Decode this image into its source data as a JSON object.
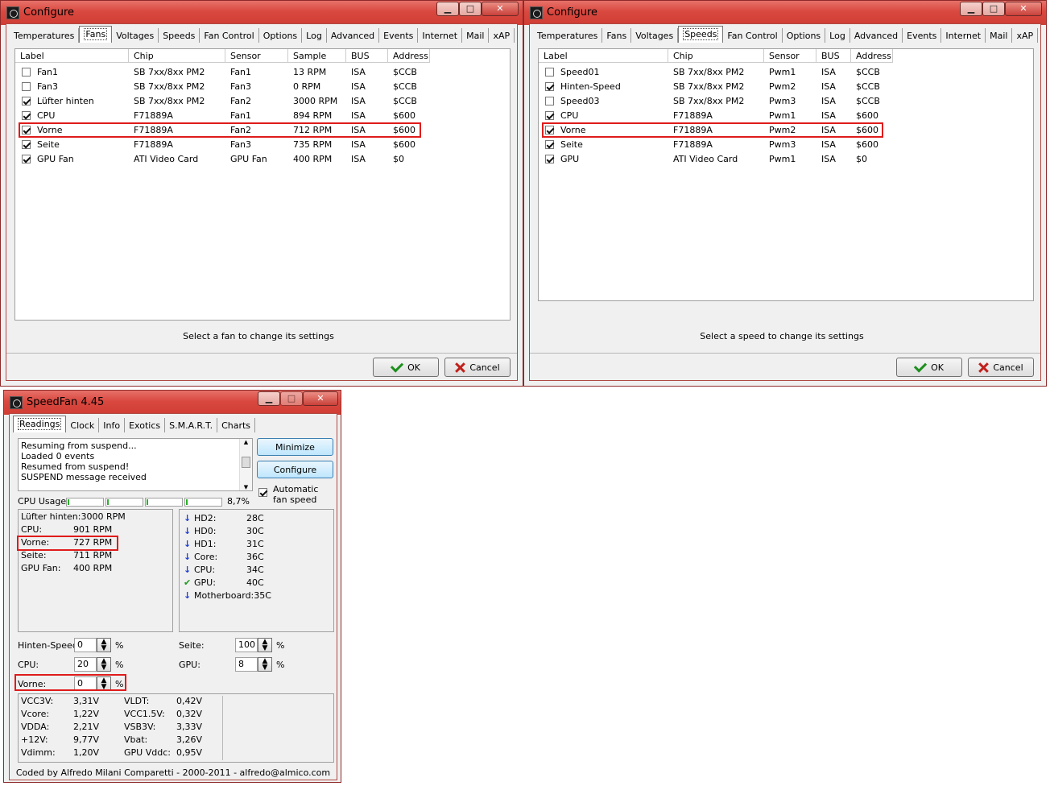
{
  "window1": {
    "title": "Configure",
    "tabs": [
      "Temperatures",
      "Fans",
      "Voltages",
      "Speeds",
      "Fan Control",
      "Options",
      "Log",
      "Advanced",
      "Events",
      "Internet",
      "Mail",
      "xAP"
    ],
    "selected_tab": "Fans",
    "columns": [
      "Label",
      "Chip",
      "Sensor",
      "Sample",
      "BUS",
      "Address"
    ],
    "rows": [
      {
        "checked": false,
        "label": "Fan1",
        "chip": "SB 7xx/8xx PM2",
        "sensor": "Fan1",
        "sample": "13 RPM",
        "bus": "ISA",
        "address": "$CCB"
      },
      {
        "checked": false,
        "label": "Fan3",
        "chip": "SB 7xx/8xx PM2",
        "sensor": "Fan3",
        "sample": "0 RPM",
        "bus": "ISA",
        "address": "$CCB"
      },
      {
        "checked": true,
        "label": "Lüfter hinten",
        "chip": "SB 7xx/8xx PM2",
        "sensor": "Fan2",
        "sample": "3000 RPM",
        "bus": "ISA",
        "address": "$CCB"
      },
      {
        "checked": true,
        "label": "CPU",
        "chip": "F71889A",
        "sensor": "Fan1",
        "sample": "894 RPM",
        "bus": "ISA",
        "address": "$600"
      },
      {
        "checked": true,
        "label": "Vorne",
        "chip": "F71889A",
        "sensor": "Fan2",
        "sample": "712 RPM",
        "bus": "ISA",
        "address": "$600"
      },
      {
        "checked": true,
        "label": "Seite",
        "chip": "F71889A",
        "sensor": "Fan3",
        "sample": "735 RPM",
        "bus": "ISA",
        "address": "$600"
      },
      {
        "checked": true,
        "label": "GPU Fan",
        "chip": "ATI Video Card",
        "sensor": "GPU Fan",
        "sample": "400 RPM",
        "bus": "ISA",
        "address": "$0"
      }
    ],
    "hint": "Select a fan to change its settings",
    "ok_label": "OK",
    "cancel_label": "Cancel"
  },
  "window2": {
    "title": "Configure",
    "tabs": [
      "Temperatures",
      "Fans",
      "Voltages",
      "Speeds",
      "Fan Control",
      "Options",
      "Log",
      "Advanced",
      "Events",
      "Internet",
      "Mail",
      "xAP"
    ],
    "selected_tab": "Speeds",
    "columns": [
      "Label",
      "Chip",
      "Sensor",
      "BUS",
      "Address"
    ],
    "rows": [
      {
        "checked": false,
        "label": "Speed01",
        "chip": "SB 7xx/8xx PM2",
        "sensor": "Pwm1",
        "bus": "ISA",
        "address": "$CCB"
      },
      {
        "checked": true,
        "label": "Hinten-Speed",
        "chip": "SB 7xx/8xx PM2",
        "sensor": "Pwm2",
        "bus": "ISA",
        "address": "$CCB"
      },
      {
        "checked": false,
        "label": "Speed03",
        "chip": "SB 7xx/8xx PM2",
        "sensor": "Pwm3",
        "bus": "ISA",
        "address": "$CCB"
      },
      {
        "checked": true,
        "label": "CPU",
        "chip": "F71889A",
        "sensor": "Pwm1",
        "bus": "ISA",
        "address": "$600"
      },
      {
        "checked": true,
        "label": "Vorne",
        "chip": "F71889A",
        "sensor": "Pwm2",
        "bus": "ISA",
        "address": "$600"
      },
      {
        "checked": true,
        "label": "Seite",
        "chip": "F71889A",
        "sensor": "Pwm3",
        "bus": "ISA",
        "address": "$600"
      },
      {
        "checked": true,
        "label": "GPU",
        "chip": "ATI Video Card",
        "sensor": "Pwm1",
        "bus": "ISA",
        "address": "$0"
      }
    ],
    "hint": "Select a speed to change its settings",
    "ok_label": "OK",
    "cancel_label": "Cancel"
  },
  "speedfan": {
    "title": "SpeedFan 4.45",
    "tabs": [
      "Readings",
      "Clock",
      "Info",
      "Exotics",
      "S.M.A.R.T.",
      "Charts"
    ],
    "log": [
      "Resuming from suspend...",
      "Loaded 0 events",
      "Resumed from suspend!",
      "SUSPEND message received"
    ],
    "minimize_label": "Minimize",
    "configure_label": "Configure",
    "auto_fan_label": "Automatic fan speed",
    "auto_fan_checked": true,
    "cpu_usage_label": "CPU Usage",
    "cpu_usage_value": "8,7%",
    "fans": [
      {
        "name": "Lüfter hinten:",
        "value": "3000 RPM"
      },
      {
        "name": "CPU:",
        "value": "901 RPM"
      },
      {
        "name": "Vorne:",
        "value": "727 RPM"
      },
      {
        "name": "Seite:",
        "value": "711 RPM"
      },
      {
        "name": "GPU Fan:",
        "value": "400 RPM"
      }
    ],
    "temps": [
      {
        "name": "HD2:",
        "value": "28C",
        "icon": "arrow-down-icon"
      },
      {
        "name": "HD0:",
        "value": "30C",
        "icon": "arrow-down-icon"
      },
      {
        "name": "HD1:",
        "value": "31C",
        "icon": "arrow-down-icon"
      },
      {
        "name": "Core:",
        "value": "36C",
        "icon": "arrow-down-icon"
      },
      {
        "name": "CPU:",
        "value": "34C",
        "icon": "arrow-down-icon"
      },
      {
        "name": "GPU:",
        "value": "40C",
        "icon": "check-icon"
      },
      {
        "name": "Motherboard:",
        "value": "35C",
        "icon": "arrow-down-icon"
      }
    ],
    "speeds": [
      {
        "name": "Hinten-Speed:",
        "value": "0",
        "unit": "%"
      },
      {
        "name": "CPU:",
        "value": "20",
        "unit": "%"
      },
      {
        "name": "Vorne:",
        "value": "0",
        "unit": "%"
      },
      {
        "name": "Seite:",
        "value": "100",
        "unit": "%"
      },
      {
        "name": "GPU:",
        "value": "8",
        "unit": "%"
      }
    ],
    "voltages_left": [
      {
        "name": "VCC3V:",
        "value": "3,31V"
      },
      {
        "name": "Vcore:",
        "value": "1,22V"
      },
      {
        "name": "VDDA:",
        "value": "2,21V"
      },
      {
        "name": "+12V:",
        "value": "9,77V"
      },
      {
        "name": "Vdimm:",
        "value": "1,20V"
      }
    ],
    "voltages_right": [
      {
        "name": "VLDT:",
        "value": "0,42V"
      },
      {
        "name": "VCC1.5V:",
        "value": "0,32V"
      },
      {
        "name": "VSB3V:",
        "value": "3,33V"
      },
      {
        "name": "Vbat:",
        "value": "3,26V"
      },
      {
        "name": "GPU Vddc:",
        "value": "0,95V"
      }
    ],
    "footer": "Coded by Alfredo Milani Comparetti - 2000-2011 - alfredo@almico.com"
  },
  "colors": {
    "highlight": "#e01b1b",
    "titlebar": "#d9483f"
  }
}
